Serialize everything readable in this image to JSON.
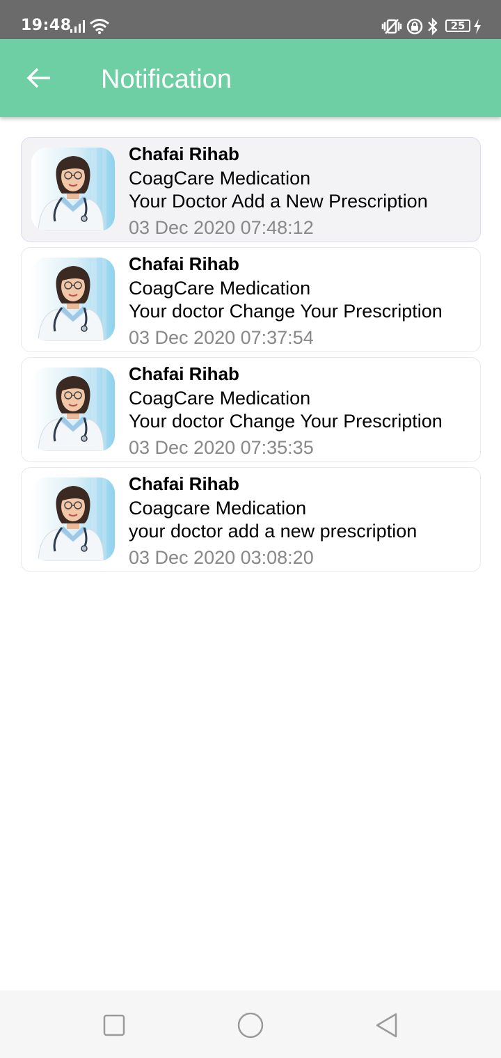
{
  "status_bar": {
    "time": "19:48",
    "battery": "25",
    "icons": [
      "signal-icon",
      "wifi-icon",
      "vibrate-icon",
      "lock-rotation-icon",
      "bluetooth-icon",
      "battery-icon",
      "charging-icon"
    ]
  },
  "app_bar": {
    "title": "Notification",
    "background": "#6dcfa3",
    "back_icon": "arrow-left-icon"
  },
  "notifications": [
    {
      "sender": "Chafai Rihab",
      "app": "CoagCare Medication",
      "message": "Your Doctor Add a New Prescription",
      "date": "03 Dec 2020 07:48:12",
      "selected": true,
      "avatar": "doctor-avatar"
    },
    {
      "sender": "Chafai Rihab",
      "app": "CoagCare Medication",
      "message": "Your doctor Change Your Prescription",
      "date": "03 Dec 2020 07:37:54",
      "selected": false,
      "avatar": "doctor-avatar"
    },
    {
      "sender": "Chafai Rihab",
      "app": "CoagCare Medication",
      "message": "Your doctor Change Your Prescription",
      "date": "03 Dec 2020 07:35:35",
      "selected": false,
      "avatar": "doctor-avatar"
    },
    {
      "sender": "Chafai Rihab",
      "app": "Coagcare Medication",
      "message": "your doctor add a new prescription",
      "date": "03 Dec 2020 03:08:20",
      "selected": false,
      "avatar": "doctor-avatar"
    }
  ],
  "nav_bar": {
    "buttons": [
      "recents-square-icon",
      "home-circle-icon",
      "back-triangle-icon"
    ]
  }
}
